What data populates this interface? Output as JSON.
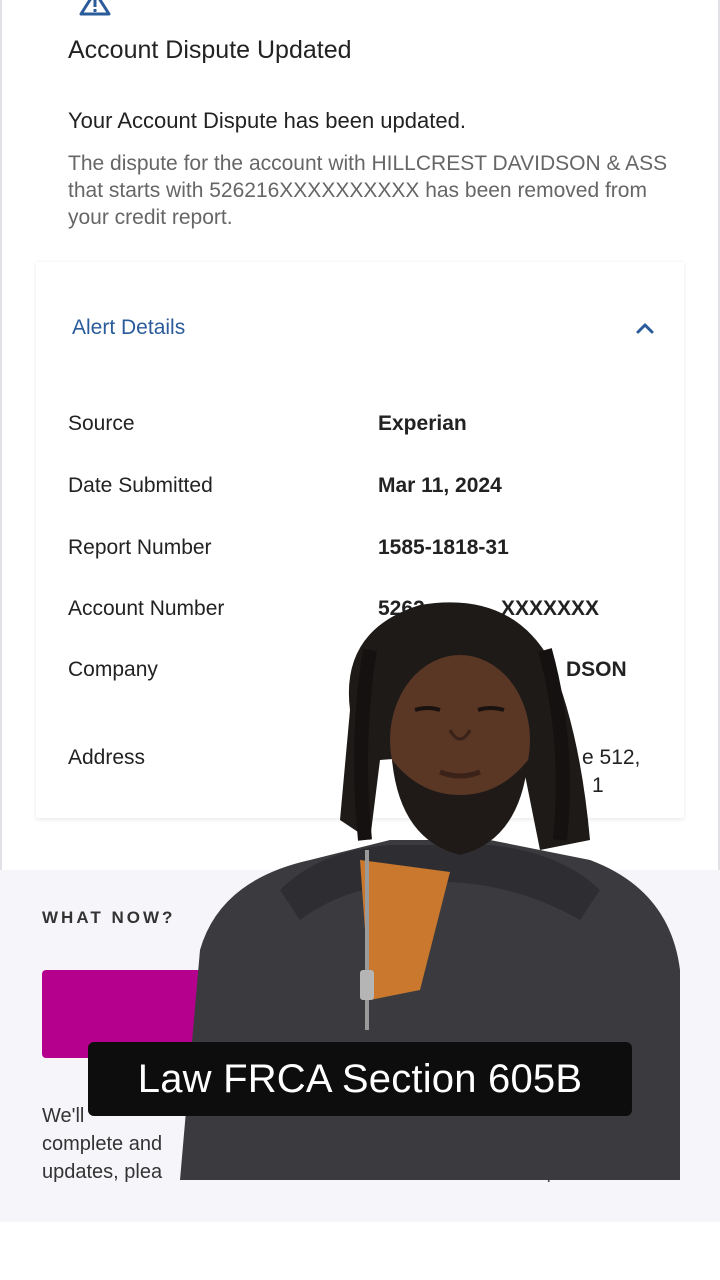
{
  "alert": {
    "title": "Account Dispute Updated",
    "subtitle": "Your Account Dispute has been updated.",
    "body": "The dispute for the account with HILLCREST DAVIDSON & ASS that starts with 526216XXXXXXXXXX has been removed from your credit report."
  },
  "details": {
    "title": "Alert Details",
    "rows": [
      {
        "label": "Source",
        "value": "Experian"
      },
      {
        "label": "Date Submitted",
        "value": "Mar 11, 2024"
      },
      {
        "label": "Report Number",
        "value": "1585-1818-31"
      },
      {
        "label": "Account Number",
        "value": "5262"
      },
      {
        "label": "Company",
        "value": ""
      },
      {
        "label": "Address",
        "value": ""
      }
    ],
    "visible_fragments": {
      "account_tail": "XXXXXXX",
      "company_tail": "DSON",
      "address_tail_1": "e 512,",
      "address_tail_2": "1"
    }
  },
  "what_now": {
    "title": "WHAT NOW?",
    "notify_lines": [
      "We'll",
      "complete and",
      "updates, plea"
    ],
    "notify_tail_3": "...report."
  },
  "caption": "Law FRCA Section 605B",
  "colors": {
    "accent_blue": "#2a5b9a",
    "button_magenta": "#b5008e",
    "warning_icon": "#2a5b9a"
  }
}
